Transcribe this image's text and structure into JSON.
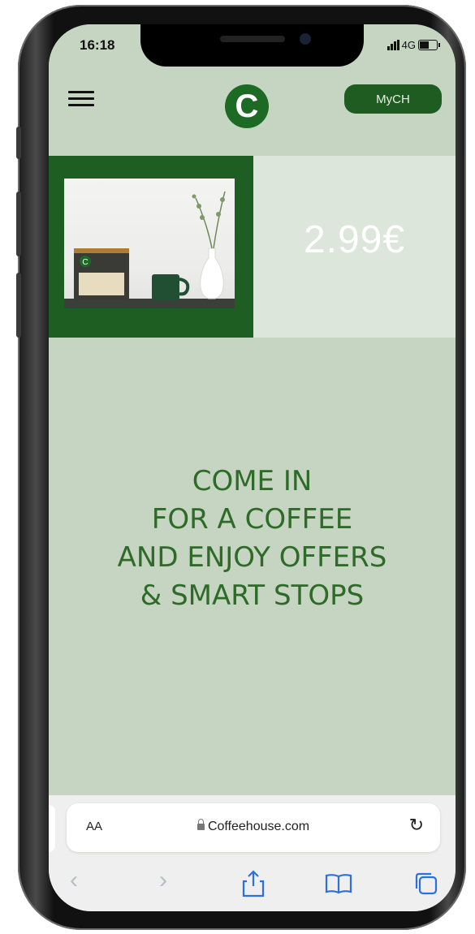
{
  "status_bar": {
    "time": "16:18",
    "network": "4G"
  },
  "header": {
    "logo_letter": "C",
    "account_button": "MyCH"
  },
  "offer": {
    "price": "2.99€",
    "product_box_letter": "C"
  },
  "message": {
    "lines": [
      "COME IN",
      "FOR A COFFEE",
      "AND ENJOY OFFERS",
      "& SMART STOPS"
    ]
  },
  "browser": {
    "text_size_label": "AA",
    "url": "Coffeehouse.com"
  },
  "colors": {
    "brand_green": "#1d6a24",
    "background": "#c6d5c2",
    "message_green": "#2e6b28",
    "safari_blue": "#2c6fe0"
  }
}
